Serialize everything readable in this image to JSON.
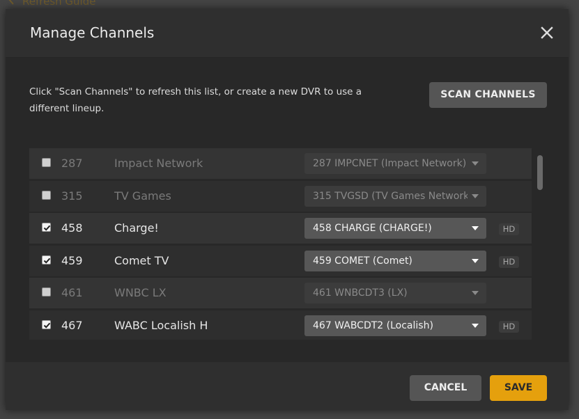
{
  "background": {
    "link_label": "Refresh Guide",
    "link_icon": "refresh-icon"
  },
  "modal": {
    "title": "Manage Channels",
    "close_icon": "close-icon",
    "hint": "Click \"Scan Channels\" to refresh this list, or create a new DVR to use a different lineup.",
    "scan_label": "SCAN CHANNELS",
    "cancel_label": "CANCEL",
    "save_label": "SAVE",
    "accent_color": "#e5a00d"
  },
  "channels": [
    {
      "enabled": false,
      "number": "287",
      "name": "Impact Network",
      "mapping": "287 IMPCNET (Impact Network)",
      "hd": ""
    },
    {
      "enabled": false,
      "number": "315",
      "name": "TV Games",
      "mapping": "315 TVGSD (TV Games Network",
      "hd": ""
    },
    {
      "enabled": true,
      "number": "458",
      "name": "Charge!",
      "mapping": "458 CHARGE (CHARGE!)",
      "hd": "HD"
    },
    {
      "enabled": true,
      "number": "459",
      "name": "Comet TV",
      "mapping": "459 COMET (Comet)",
      "hd": "HD"
    },
    {
      "enabled": false,
      "number": "461",
      "name": "WNBC LX",
      "mapping": "461 WNBCDT3 (LX)",
      "hd": ""
    },
    {
      "enabled": true,
      "number": "467",
      "name": "WABC Localish H",
      "mapping": "467 WABCDT2 (Localish)",
      "hd": "HD"
    }
  ]
}
